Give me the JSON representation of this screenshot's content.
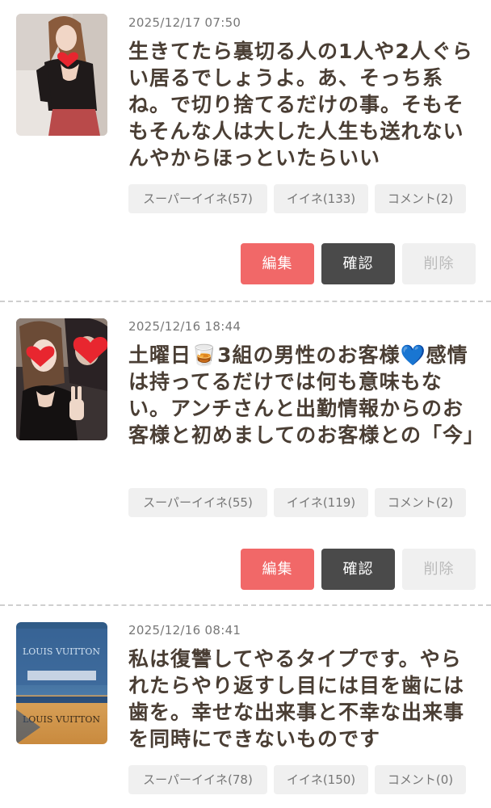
{
  "posts": [
    {
      "date": "2025/12/17 07:50",
      "text": "生きてたら裏切る人の1人や2人ぐらい居るでしょうよ。あ、そっち系ね。で切り捨てるだけの事。そもそもそんな人は大した人生も送れないんやからほっといたらいい",
      "super_like": "スーパーイイネ(57)",
      "like": "イイネ(133)",
      "comment": "コメント(2)",
      "edit": "編集",
      "confirm": "確認",
      "delete": "削除"
    },
    {
      "date": "2025/12/16 18:44",
      "text": "土曜日🥃3組の男性のお客様💙感情は持ってるだけでは何も意味もない。アンチさんと出勤情報からのお客様と初めましてのお客様との「今」",
      "super_like": "スーパーイイネ(55)",
      "like": "イイネ(119)",
      "comment": "コメント(2)",
      "edit": "編集",
      "confirm": "確認",
      "delete": "削除"
    },
    {
      "date": "2025/12/16 08:41",
      "text": "私は復讐してやるタイプです。やられたらやり返すし目には目を歯には歯を。幸せな出来事と不幸な出来事を同時にできないものです",
      "super_like": "スーパーイイネ(78)",
      "like": "イイネ(150)",
      "comment": "コメント(0)",
      "photo_text_top": "LOUIS VUITTON",
      "photo_text_bottom": "LOUIS VUITTON"
    }
  ],
  "colors": {
    "edit_button": "#f16868",
    "confirm_button": "#4a4a4a",
    "delete_button": "#f0f0f0",
    "post_text": "#4a3e34",
    "stat_background": "#f0f0f0"
  }
}
